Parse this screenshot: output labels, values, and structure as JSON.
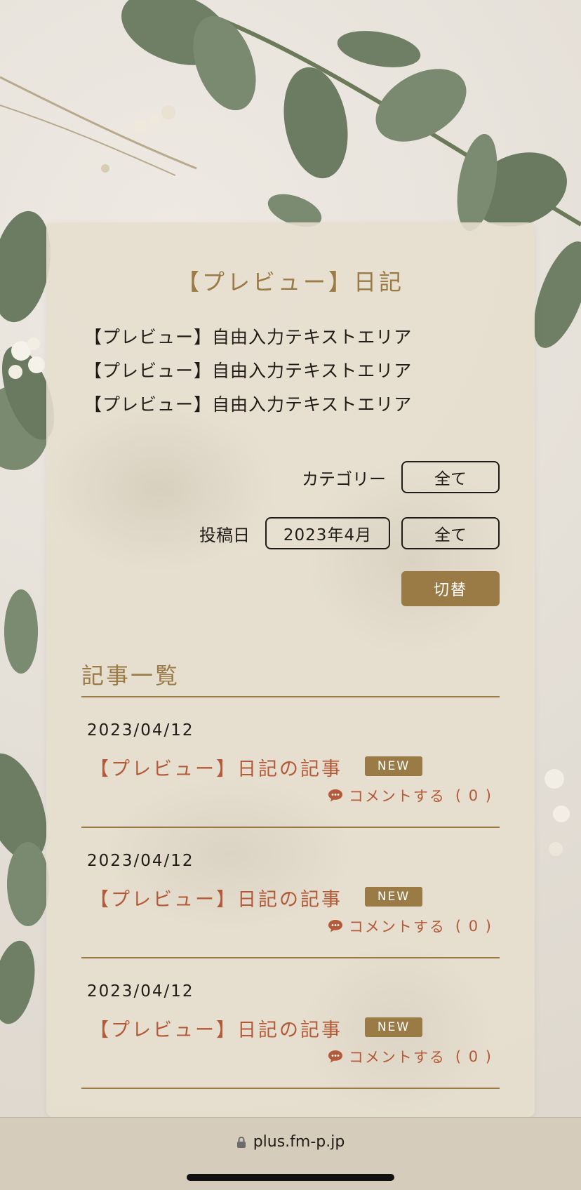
{
  "page": {
    "title": "【プレビュー】日記",
    "free_text_lines": [
      "【プレビュー】自由入力テキストエリア",
      "【プレビュー】自由入力テキストエリア",
      "【プレビュー】自由入力テキストエリア"
    ]
  },
  "filters": {
    "category_label": "カテゴリー",
    "category_value": "全て",
    "date_label": "投稿日",
    "date_value": "2023年4月",
    "date_all_value": "全て",
    "switch_label": "切替"
  },
  "articles_section": {
    "title": "記事一覧",
    "items": [
      {
        "date": "2023/04/12",
        "title": "【プレビュー】日記の記事",
        "badge": "NEW",
        "comment_label": "コメントする",
        "comment_count": "0"
      },
      {
        "date": "2023/04/12",
        "title": "【プレビュー】日記の記事",
        "badge": "NEW",
        "comment_label": "コメントする",
        "comment_count": "0"
      },
      {
        "date": "2023/04/12",
        "title": "【プレビュー】日記の記事",
        "badge": "NEW",
        "comment_label": "コメントする",
        "comment_count": "0"
      }
    ]
  },
  "browser": {
    "url": "plus.fm-p.jp",
    "lock_icon": "lock-icon"
  },
  "colors": {
    "accent": "#9a7a45",
    "link": "#b35a38",
    "text": "#1f1c17"
  }
}
